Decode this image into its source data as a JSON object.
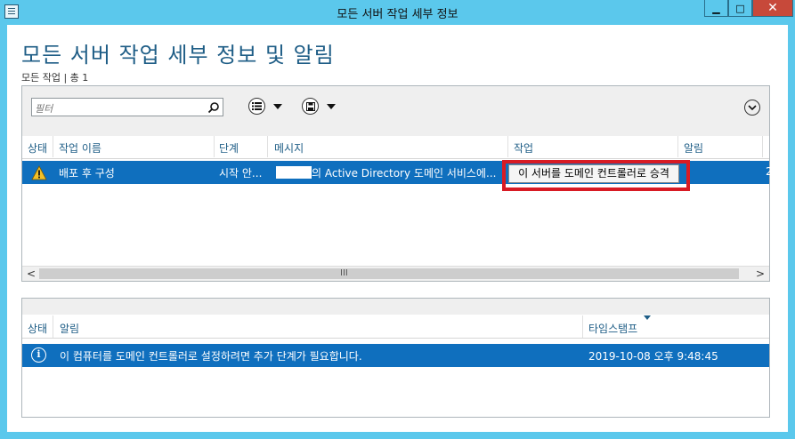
{
  "window": {
    "title": "모든 서버 작업 세부 정보",
    "minimize": "▁",
    "maximize": "□",
    "close": "✕"
  },
  "page": {
    "title": "모든 서버 작업 세부 정보 및 알림",
    "subtitle": "모든 작업 | 총 1"
  },
  "toolbar": {
    "filter_placeholder": "필터",
    "icons": [
      "search-icon",
      "list-options-icon",
      "save-icon",
      "expand-icon"
    ]
  },
  "tasks_table": {
    "columns": [
      "상태",
      "작업 이름",
      "단계",
      "메시지",
      "작업",
      "알림"
    ],
    "rows": [
      {
        "status_icon": "warning-icon",
        "name": "배포 후 구성",
        "stage": "시작 안...",
        "message": "의 Active Directory 도메인 서비스에...",
        "action": "이 서버를 도메인 컨트롤러로 승격",
        "extra": "2"
      }
    ]
  },
  "notifications_table": {
    "columns": [
      "상태",
      "알림",
      "타임스탬프"
    ],
    "rows": [
      {
        "status_icon": "info-icon",
        "info_glyph": "i",
        "text": "이 컴퓨터를 도메인 컨트롤러로 설정하려면 추가 단계가 필요합니다.",
        "timestamp": "2019-10-08 오후 9:48:45"
      }
    ]
  },
  "scrollbar": {
    "left_arrow": "<",
    "right_arrow": ">",
    "grip": "III"
  },
  "colors": {
    "chrome": "#5bc8ec",
    "selection": "#0f6fbe",
    "title_text": "#1e5d86",
    "highlight_box": "#d81b24"
  }
}
